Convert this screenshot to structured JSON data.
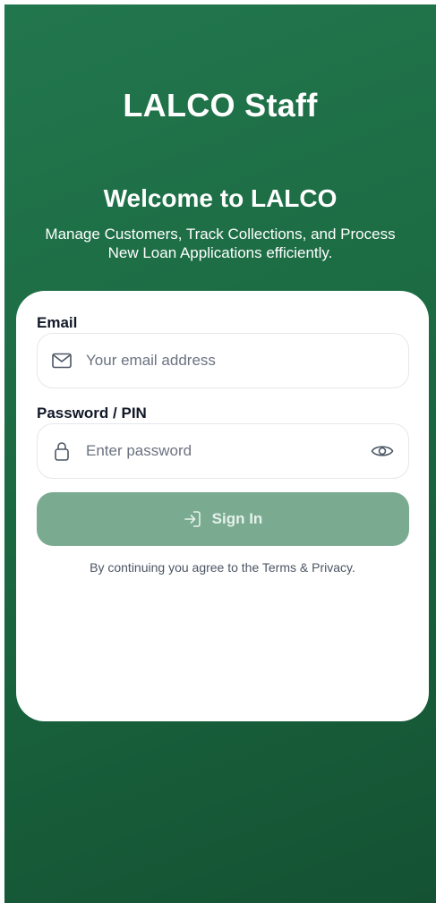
{
  "header": {
    "app_title": "LALCO Staff",
    "welcome_title": "Welcome to LALCO",
    "subtitle": "Manage Customers, Track Collections, and Process New Loan Applications efficiently."
  },
  "form": {
    "email_label": "Email",
    "email_placeholder": "Your email address",
    "email_icon": "mail-icon",
    "password_label": "Password / PIN",
    "password_placeholder": "Enter password",
    "password_icon": "lock-icon",
    "toggle_icon": "eye-icon",
    "sign_in_label": "Sign In",
    "sign_in_icon": "sign-in-icon",
    "terms_text": "By continuing you agree to the Terms & Privacy."
  },
  "colors": {
    "brand_green": "#1b6a42",
    "button_disabled": "#7aab91",
    "card": "#ffffff"
  }
}
